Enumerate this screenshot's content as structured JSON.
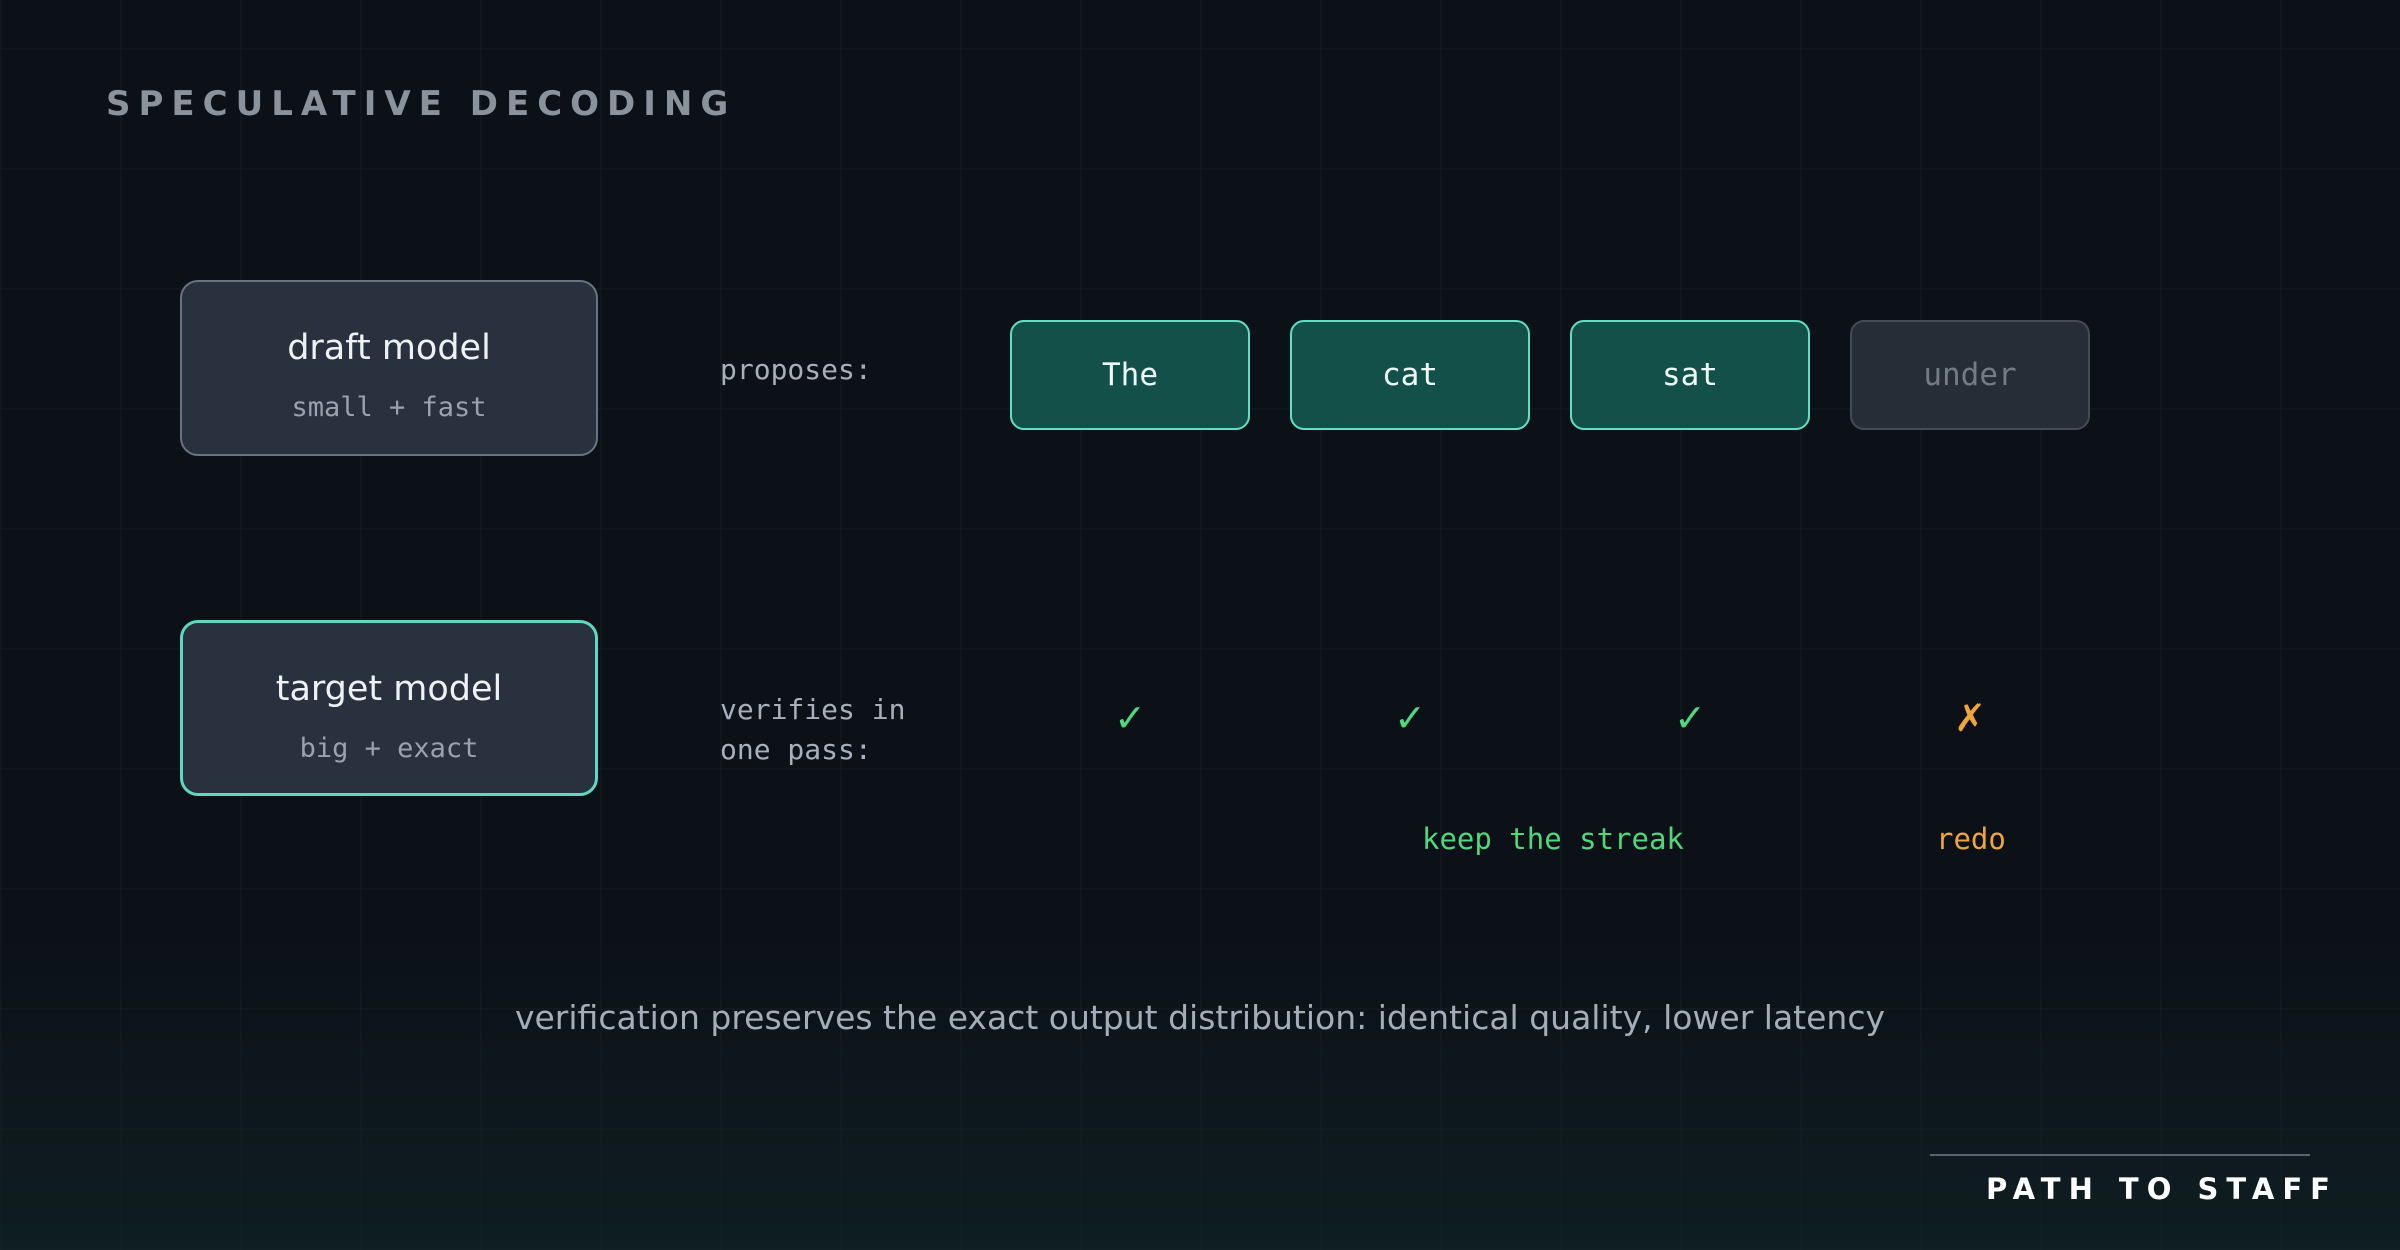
{
  "title": "SPECULATIVE DECODING",
  "draft_model": {
    "name": "draft model",
    "subtitle": "small + fast"
  },
  "target_model": {
    "name": "target model",
    "subtitle": "big + exact"
  },
  "proposes_label": "proposes:",
  "verifies_label": "verifies in\none pass:",
  "tokens": [
    {
      "text": "The",
      "status": "accepted",
      "mark": "✓"
    },
    {
      "text": "cat",
      "status": "accepted",
      "mark": "✓"
    },
    {
      "text": "sat",
      "status": "accepted",
      "mark": "✓"
    },
    {
      "text": "under",
      "status": "rejected",
      "mark": "✗"
    }
  ],
  "notes": {
    "keep": "keep the streak",
    "redo": "redo"
  },
  "caption": "verification preserves the exact output distribution: identical quality, lower latency",
  "brand": "PATH TO STAFF",
  "colors": {
    "background": "#0c1118",
    "accent_teal": "#5fe0c5",
    "accepted_green": "#4fd87c",
    "rejected_orange": "#f0a53c"
  }
}
